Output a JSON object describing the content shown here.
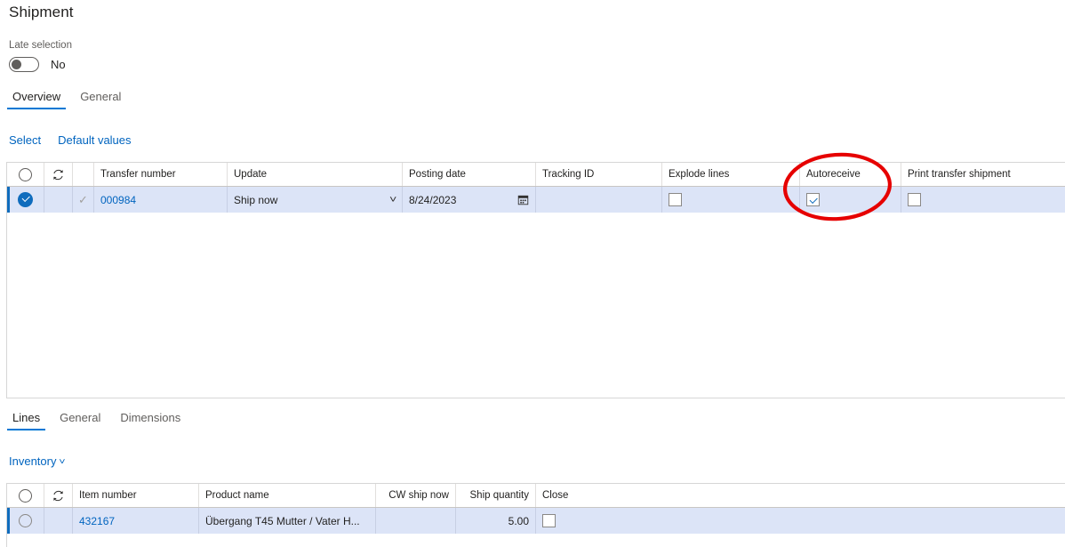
{
  "page": {
    "title": "Shipment"
  },
  "late_selection": {
    "label": "Late selection",
    "value": "No",
    "icon": "toggle-off-icon"
  },
  "top_tabs": [
    {
      "label": "Overview",
      "active": true
    },
    {
      "label": "General",
      "active": false
    }
  ],
  "top_commands": [
    {
      "label": "Select"
    },
    {
      "label": "Default values"
    }
  ],
  "top_grid": {
    "columns": [
      {
        "label": "",
        "name": "select-all"
      },
      {
        "label": "",
        "name": "refresh"
      },
      {
        "label": "",
        "name": "mark"
      },
      {
        "label": "Transfer number",
        "name": "transfer-number"
      },
      {
        "label": "Update",
        "name": "update"
      },
      {
        "label": "Posting date",
        "name": "posting-date"
      },
      {
        "label": "Tracking ID",
        "name": "tracking-id"
      },
      {
        "label": "Explode lines",
        "name": "explode-lines"
      },
      {
        "label": "Autoreceive",
        "name": "autoreceive"
      },
      {
        "label": "Print transfer shipment",
        "name": "print-transfer-shipment"
      }
    ],
    "rows": [
      {
        "selected": true,
        "marked": true,
        "transfer_number": "000984",
        "update": "Ship now",
        "posting_date": "8/24/2023",
        "tracking_id": "",
        "explode_lines": false,
        "autoreceive": true,
        "print_transfer_shipment": false
      }
    ]
  },
  "bottom_tabs": [
    {
      "label": "Lines",
      "active": true
    },
    {
      "label": "General",
      "active": false
    },
    {
      "label": "Dimensions",
      "active": false
    }
  ],
  "bottom_commands": [
    {
      "label": "Inventory",
      "icon": "chevron-down-icon"
    }
  ],
  "bottom_grid": {
    "columns": [
      {
        "label": "",
        "name": "select-all"
      },
      {
        "label": "",
        "name": "refresh"
      },
      {
        "label": "Item number",
        "name": "item-number"
      },
      {
        "label": "Product name",
        "name": "product-name"
      },
      {
        "label": "CW ship now",
        "name": "cw-ship-now"
      },
      {
        "label": "Ship quantity",
        "name": "ship-quantity"
      },
      {
        "label": "Close",
        "name": "close"
      }
    ],
    "rows": [
      {
        "selected": true,
        "item_number": "432167",
        "product_name": "Übergang T45 Mutter / Vater H...",
        "cw_ship_now": "",
        "ship_quantity": "5.00",
        "close": false
      }
    ]
  },
  "annotation": {
    "name": "red-ellipse-highlight",
    "target": "Autoreceive",
    "color": "#e60000"
  },
  "colors": {
    "accent": "#0078d4",
    "link": "#0064bf",
    "row_selected_bg": "#dce4f7",
    "annotation_red": "#e60000"
  }
}
